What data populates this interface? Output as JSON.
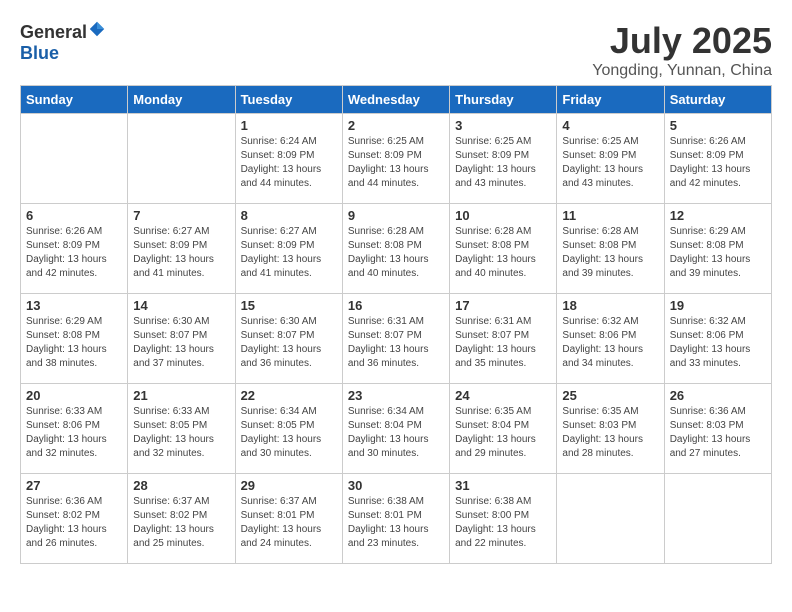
{
  "logo": {
    "text_general": "General",
    "text_blue": "Blue"
  },
  "header": {
    "month": "July 2025",
    "location": "Yongding, Yunnan, China"
  },
  "weekdays": [
    "Sunday",
    "Monday",
    "Tuesday",
    "Wednesday",
    "Thursday",
    "Friday",
    "Saturday"
  ],
  "weeks": [
    [
      {
        "day": "",
        "info": ""
      },
      {
        "day": "",
        "info": ""
      },
      {
        "day": "1",
        "info": "Sunrise: 6:24 AM\nSunset: 8:09 PM\nDaylight: 13 hours and 44 minutes."
      },
      {
        "day": "2",
        "info": "Sunrise: 6:25 AM\nSunset: 8:09 PM\nDaylight: 13 hours and 44 minutes."
      },
      {
        "day": "3",
        "info": "Sunrise: 6:25 AM\nSunset: 8:09 PM\nDaylight: 13 hours and 43 minutes."
      },
      {
        "day": "4",
        "info": "Sunrise: 6:25 AM\nSunset: 8:09 PM\nDaylight: 13 hours and 43 minutes."
      },
      {
        "day": "5",
        "info": "Sunrise: 6:26 AM\nSunset: 8:09 PM\nDaylight: 13 hours and 42 minutes."
      }
    ],
    [
      {
        "day": "6",
        "info": "Sunrise: 6:26 AM\nSunset: 8:09 PM\nDaylight: 13 hours and 42 minutes."
      },
      {
        "day": "7",
        "info": "Sunrise: 6:27 AM\nSunset: 8:09 PM\nDaylight: 13 hours and 41 minutes."
      },
      {
        "day": "8",
        "info": "Sunrise: 6:27 AM\nSunset: 8:09 PM\nDaylight: 13 hours and 41 minutes."
      },
      {
        "day": "9",
        "info": "Sunrise: 6:28 AM\nSunset: 8:08 PM\nDaylight: 13 hours and 40 minutes."
      },
      {
        "day": "10",
        "info": "Sunrise: 6:28 AM\nSunset: 8:08 PM\nDaylight: 13 hours and 40 minutes."
      },
      {
        "day": "11",
        "info": "Sunrise: 6:28 AM\nSunset: 8:08 PM\nDaylight: 13 hours and 39 minutes."
      },
      {
        "day": "12",
        "info": "Sunrise: 6:29 AM\nSunset: 8:08 PM\nDaylight: 13 hours and 39 minutes."
      }
    ],
    [
      {
        "day": "13",
        "info": "Sunrise: 6:29 AM\nSunset: 8:08 PM\nDaylight: 13 hours and 38 minutes."
      },
      {
        "day": "14",
        "info": "Sunrise: 6:30 AM\nSunset: 8:07 PM\nDaylight: 13 hours and 37 minutes."
      },
      {
        "day": "15",
        "info": "Sunrise: 6:30 AM\nSunset: 8:07 PM\nDaylight: 13 hours and 36 minutes."
      },
      {
        "day": "16",
        "info": "Sunrise: 6:31 AM\nSunset: 8:07 PM\nDaylight: 13 hours and 36 minutes."
      },
      {
        "day": "17",
        "info": "Sunrise: 6:31 AM\nSunset: 8:07 PM\nDaylight: 13 hours and 35 minutes."
      },
      {
        "day": "18",
        "info": "Sunrise: 6:32 AM\nSunset: 8:06 PM\nDaylight: 13 hours and 34 minutes."
      },
      {
        "day": "19",
        "info": "Sunrise: 6:32 AM\nSunset: 8:06 PM\nDaylight: 13 hours and 33 minutes."
      }
    ],
    [
      {
        "day": "20",
        "info": "Sunrise: 6:33 AM\nSunset: 8:06 PM\nDaylight: 13 hours and 32 minutes."
      },
      {
        "day": "21",
        "info": "Sunrise: 6:33 AM\nSunset: 8:05 PM\nDaylight: 13 hours and 32 minutes."
      },
      {
        "day": "22",
        "info": "Sunrise: 6:34 AM\nSunset: 8:05 PM\nDaylight: 13 hours and 30 minutes."
      },
      {
        "day": "23",
        "info": "Sunrise: 6:34 AM\nSunset: 8:04 PM\nDaylight: 13 hours and 30 minutes."
      },
      {
        "day": "24",
        "info": "Sunrise: 6:35 AM\nSunset: 8:04 PM\nDaylight: 13 hours and 29 minutes."
      },
      {
        "day": "25",
        "info": "Sunrise: 6:35 AM\nSunset: 8:03 PM\nDaylight: 13 hours and 28 minutes."
      },
      {
        "day": "26",
        "info": "Sunrise: 6:36 AM\nSunset: 8:03 PM\nDaylight: 13 hours and 27 minutes."
      }
    ],
    [
      {
        "day": "27",
        "info": "Sunrise: 6:36 AM\nSunset: 8:02 PM\nDaylight: 13 hours and 26 minutes."
      },
      {
        "day": "28",
        "info": "Sunrise: 6:37 AM\nSunset: 8:02 PM\nDaylight: 13 hours and 25 minutes."
      },
      {
        "day": "29",
        "info": "Sunrise: 6:37 AM\nSunset: 8:01 PM\nDaylight: 13 hours and 24 minutes."
      },
      {
        "day": "30",
        "info": "Sunrise: 6:38 AM\nSunset: 8:01 PM\nDaylight: 13 hours and 23 minutes."
      },
      {
        "day": "31",
        "info": "Sunrise: 6:38 AM\nSunset: 8:00 PM\nDaylight: 13 hours and 22 minutes."
      },
      {
        "day": "",
        "info": ""
      },
      {
        "day": "",
        "info": ""
      }
    ]
  ]
}
